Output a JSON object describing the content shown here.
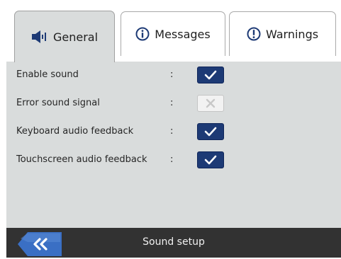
{
  "tabs": [
    {
      "label": "General",
      "icon": "speaker-icon",
      "active": true
    },
    {
      "label": "Messages",
      "icon": "info-icon",
      "active": false
    },
    {
      "label": "Warnings",
      "icon": "warning-icon",
      "active": false
    }
  ],
  "settings": [
    {
      "label": "Enable sound",
      "separator": ":",
      "checked": true
    },
    {
      "label": "Error sound signal",
      "separator": ":",
      "checked": false
    },
    {
      "label": "Keyboard audio feedback",
      "separator": ":",
      "checked": true
    },
    {
      "label": "Touchscreen audio feedback",
      "separator": ":",
      "checked": true
    }
  ],
  "footer": {
    "title": "Sound setup",
    "back_icon": "double-chevron-left-icon"
  },
  "colors": {
    "panel_bg": "#d9dcdc",
    "checkbox_on": "#1d3a75",
    "footer_bg": "#323232",
    "back_button": "#3a6fc4"
  }
}
